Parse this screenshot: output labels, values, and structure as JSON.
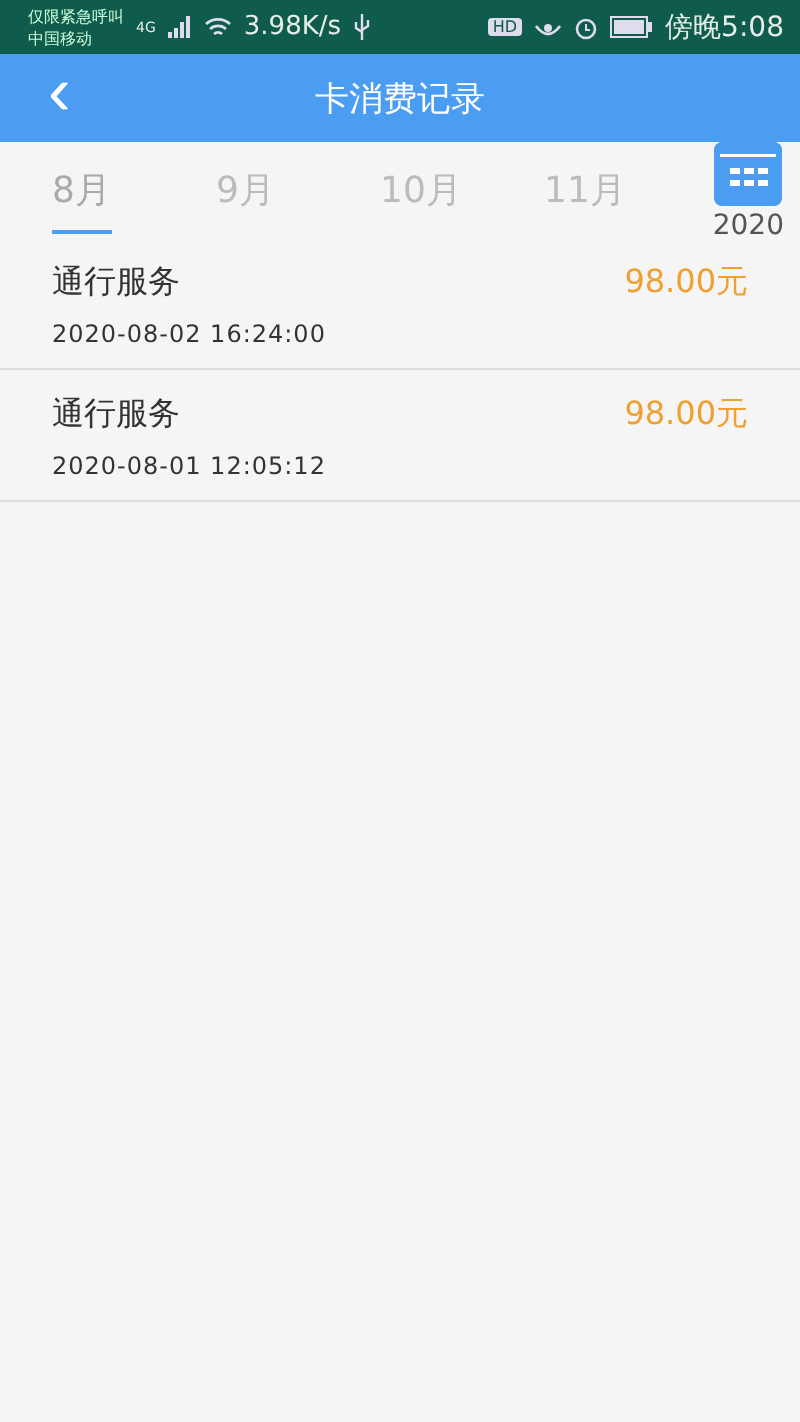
{
  "status_bar": {
    "carrier_top": "仅限紧急呼叫",
    "carrier_bottom": "中国移动",
    "network": "4G",
    "speed": "3.98K/s",
    "hd": "HD",
    "time": "傍晚5:08"
  },
  "header": {
    "back": "‹",
    "title": "卡消费记录"
  },
  "months": [
    {
      "label": "8月",
      "selected": true
    },
    {
      "label": "9月",
      "selected": false
    },
    {
      "label": "10月",
      "selected": false
    },
    {
      "label": "11月",
      "selected": false
    }
  ],
  "year": "2020",
  "records": [
    {
      "name": "通行服务",
      "time": "2020-08-02 16:24:00",
      "amount": "98.00元"
    },
    {
      "name": "通行服务",
      "time": "2020-08-01 12:05:12",
      "amount": "98.00元"
    }
  ]
}
